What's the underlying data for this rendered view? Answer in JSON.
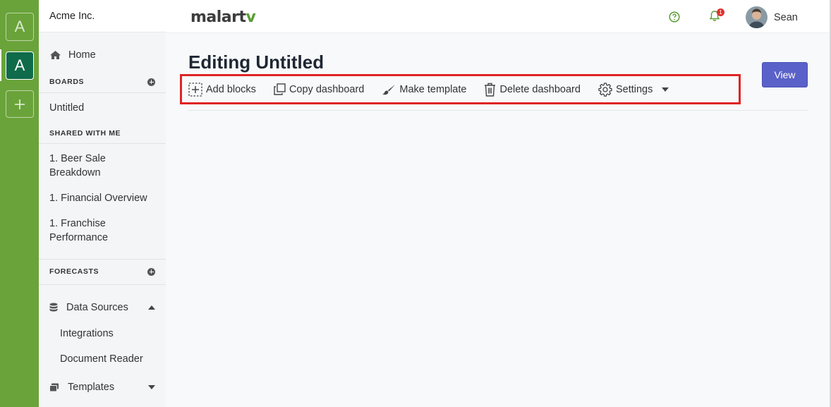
{
  "workspaces": {
    "items": [
      {
        "letter": "A",
        "active": false
      },
      {
        "letter": "A",
        "active": true
      }
    ],
    "add_icon": "plus-icon"
  },
  "sidebar": {
    "org_name": "Acme Inc.",
    "home_label": "Home",
    "boards_heading": "BOARDS",
    "boards": [
      "Untitled"
    ],
    "shared_heading": "SHARED WITH ME",
    "shared": [
      "1. Beer Sale Breakdown",
      "1. Financial Overview",
      "1. Franchise Performance"
    ],
    "forecasts_heading": "FORECASTS",
    "data_sources_label": "Data Sources",
    "data_sources_items": [
      "Integrations",
      "Document Reader"
    ],
    "templates_label": "Templates"
  },
  "topbar": {
    "logo_text": "malart",
    "logo_accent": "v",
    "notification_count": "1",
    "username": "Sean",
    "help_icon": "help-circle-icon",
    "bell_icon": "bell-icon"
  },
  "main": {
    "title": "Editing Untitled",
    "view_button": "View",
    "toolbar": {
      "add_blocks": "Add blocks",
      "copy_dashboard": "Copy dashboard",
      "make_template": "Make template",
      "delete_dashboard": "Delete dashboard",
      "settings": "Settings"
    }
  },
  "colors": {
    "rail": "#6aa33a",
    "active_workspace": "#0f6b4a",
    "accent_button": "#5a61c8",
    "highlight_box": "#e02424",
    "logo_leaf": "#5a9e33"
  }
}
